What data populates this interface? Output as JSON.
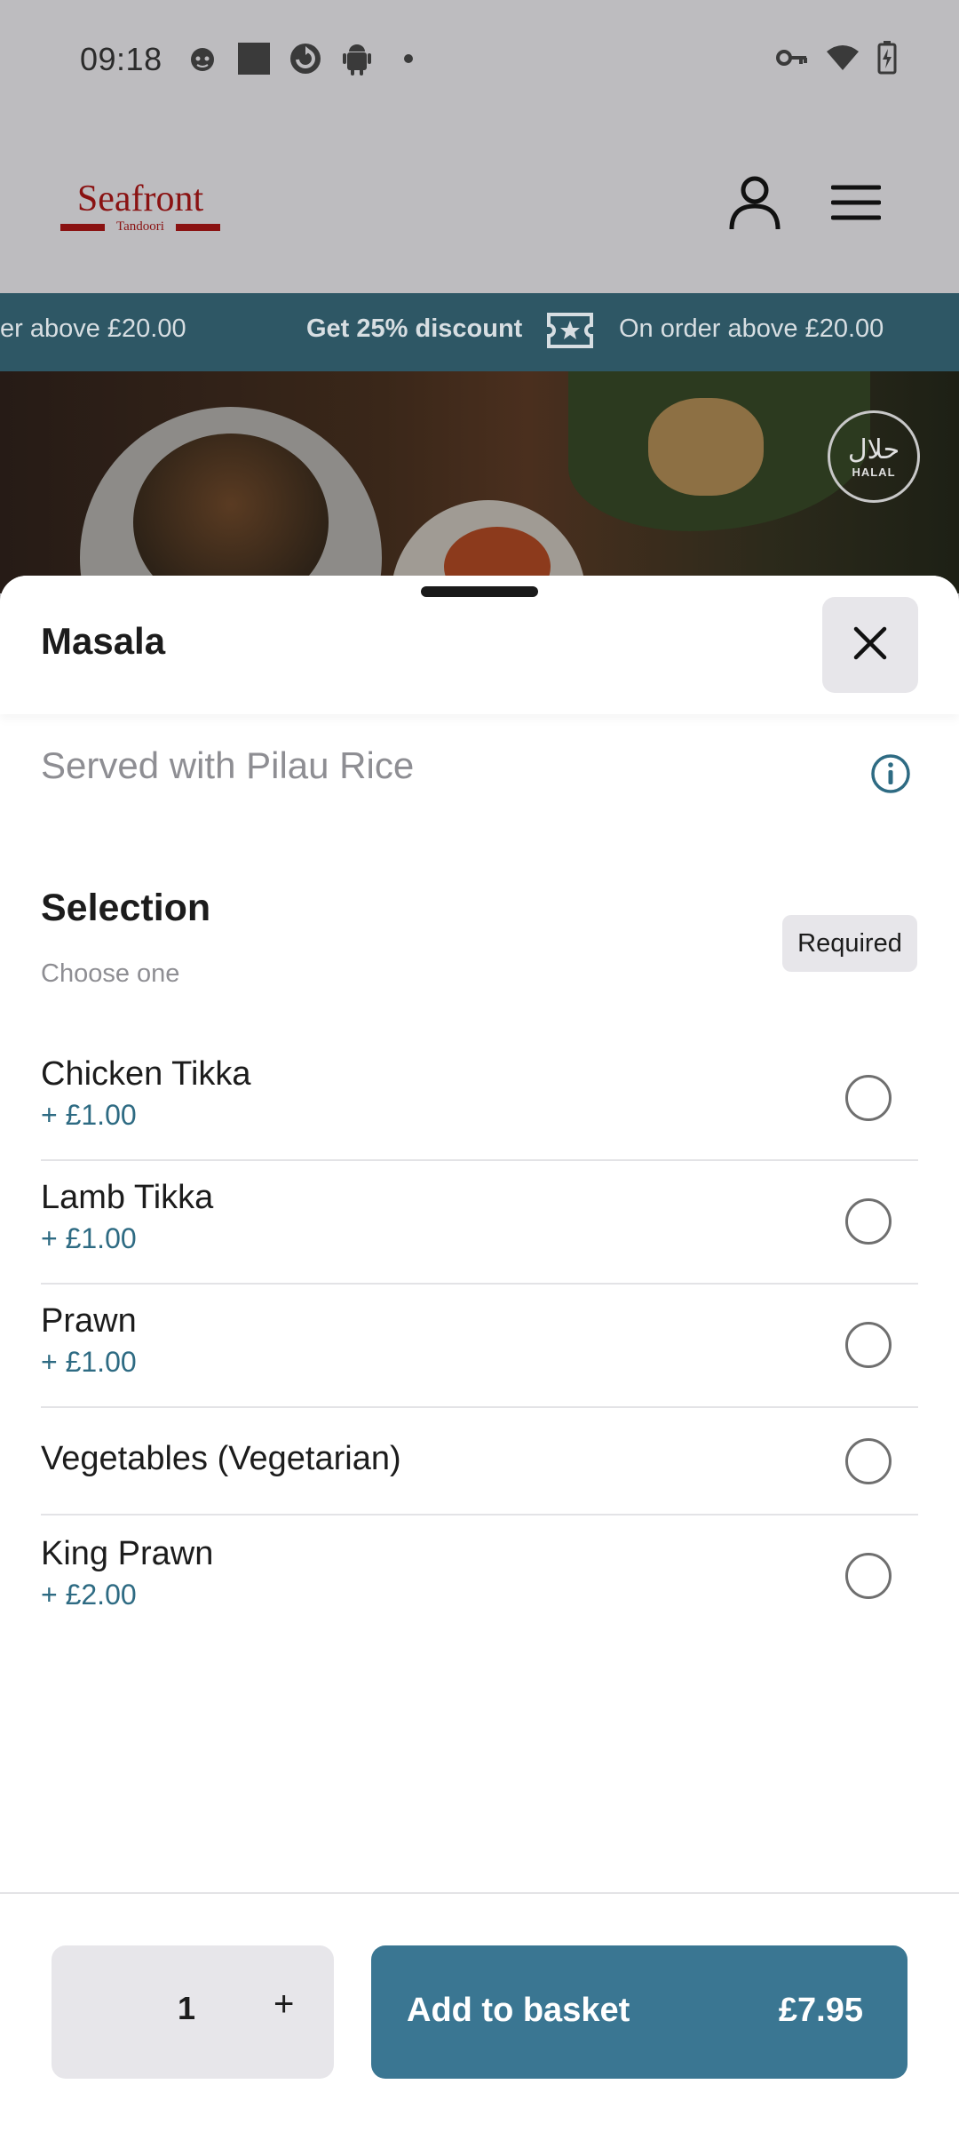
{
  "status_bar": {
    "time": "09:18",
    "left_icons": [
      "cat-face-icon",
      "square-icon",
      "refresh-app-icon",
      "android-icon",
      "dot-icon"
    ],
    "right_icons": [
      "key-icon",
      "wifi-icon",
      "battery-charging-icon"
    ]
  },
  "header": {
    "logo_text": "Seafront",
    "logo_subtext": "Tandoori",
    "account_icon": "person-icon",
    "menu_icon": "hamburger-menu-icon"
  },
  "promo": {
    "left_fragment": "er above £20.00",
    "headline": "Get 25% discount",
    "icon": "ticket-star-icon",
    "detail": "On order above £20.00"
  },
  "hero": {
    "badge_arabic": "حلال",
    "badge_text": "HALAL"
  },
  "sheet": {
    "title": "Masala",
    "description": "Served with Pilau Rice",
    "selection": {
      "title": "Selection",
      "subtitle": "Choose one",
      "badge": "Required",
      "options": [
        {
          "name": "Chicken Tikka",
          "price": "+ £1.00",
          "selected": false
        },
        {
          "name": "Lamb Tikka",
          "price": "+ £1.00",
          "selected": false
        },
        {
          "name": "Prawn",
          "price": "+ £1.00",
          "selected": false
        },
        {
          "name": "Vegetables (Vegetarian)",
          "price": "",
          "selected": false
        },
        {
          "name": "King Prawn",
          "price": "+ £2.00",
          "selected": false
        }
      ]
    }
  },
  "footer": {
    "quantity": "1",
    "plus_label": "+",
    "add_label": "Add to basket",
    "total": "£7.95"
  },
  "colors": {
    "accent": "#3a7692",
    "promo_bg": "#2e5765",
    "brand_red": "#8a1212",
    "price_text": "#2e6b83"
  }
}
